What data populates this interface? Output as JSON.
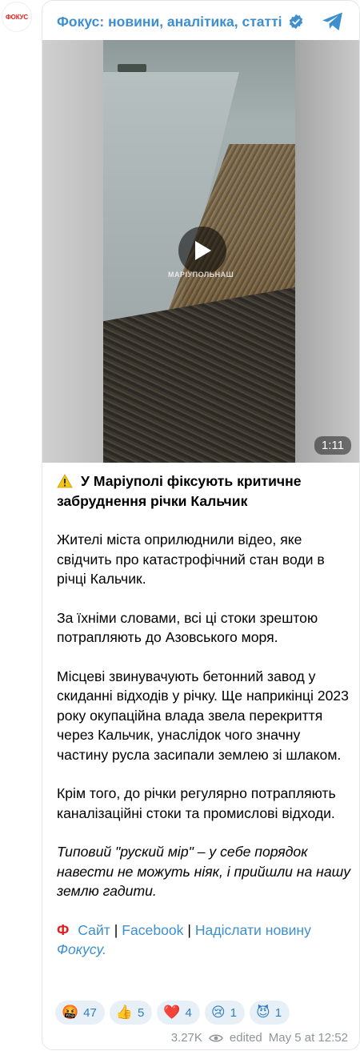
{
  "avatar": {
    "text": "ФОКУС"
  },
  "header": {
    "channel_name": "Фокус: новини, аналітика, статті",
    "verified_icon": "verified-badge-icon",
    "share_icon": "telegram-icon"
  },
  "video": {
    "duration": "1:11",
    "watermark": "МАРІУПОЛЬНАШ"
  },
  "post": {
    "title": "У Маріуполі фіксують критичне забруднення річки Кальчик",
    "p1": "Жителі міста оприлюднили відео, яке свідчить про катастрофічний стан води в річці Кальчик.",
    "p2": "За їхніми словами, всі ці стоки зрештою потрапляють до Азовського моря.",
    "p3": "Місцеві звинувачують бетонний завод у скиданні відходів у річку. Ще наприкінці 2023 року окупаційна влада звела перекриття через Кальчик, унаслідок чого значну частину русла засипали землею зі шлаком.",
    "p4": "Крім того, до річки регулярно потрапляють каналізаційні стоки та промислові відходи.",
    "p5": "Типовий \"руский мір\" – у себе порядок навести не можуть ніяк, і прийшли на нашу землю гадити.",
    "links": {
      "logo": "Ф",
      "site": "Сайт",
      "sep1": "|",
      "facebook": "Facebook",
      "sep2": "|",
      "send": "Надіслати новину",
      "fokus": "Фокусу",
      "dot": "."
    }
  },
  "reactions": [
    {
      "emoji": "🤬",
      "count": "47"
    },
    {
      "emoji": "👍",
      "count": "5"
    },
    {
      "emoji": "❤️",
      "count": "4"
    },
    {
      "emoji": "😢",
      "count": "1"
    },
    {
      "emoji": "😈",
      "count": "1"
    }
  ],
  "footer": {
    "views": "3.27K",
    "edited": "edited",
    "date": "May 5 at 12:52"
  }
}
